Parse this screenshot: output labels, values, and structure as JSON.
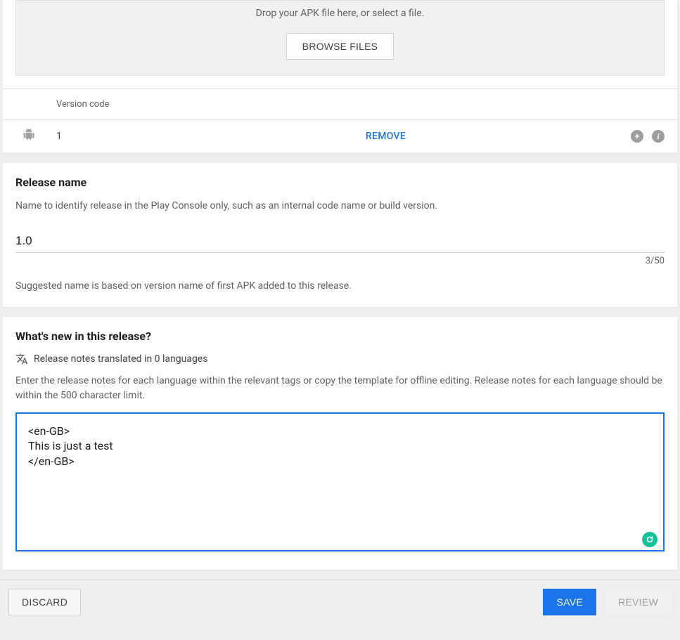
{
  "apk": {
    "drop_text": "Drop your APK file here, or select a file.",
    "browse_label": "BROWSE FILES",
    "col_version_code": "Version code",
    "row": {
      "version_code": "1",
      "remove_label": "REMOVE"
    }
  },
  "release_name": {
    "title": "Release name",
    "help": "Name to identify release in the Play Console only, such as an internal code name or build version.",
    "value": "1.0",
    "counter": "3/50",
    "suggest": "Suggested name is based on version name of first APK added to this release."
  },
  "whats_new": {
    "title": "What's new in this release?",
    "translated_text": "Release notes translated in 0 languages",
    "help": "Enter the release notes for each language within the relevant tags or copy the template for offline editing. Release notes for each language should be within the 500 character limit.",
    "textarea_value": "<en-GB>\nThis is just a test\n</en-GB>"
  },
  "footer": {
    "discard_label": "DISCARD",
    "save_label": "SAVE",
    "review_label": "REVIEW"
  }
}
